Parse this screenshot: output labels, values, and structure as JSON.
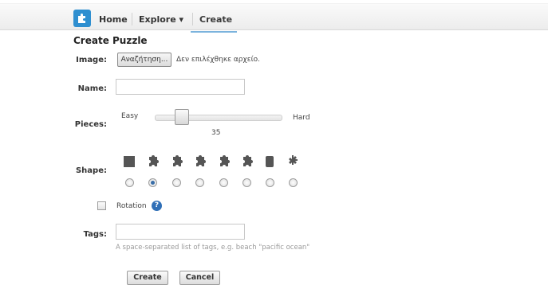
{
  "nav": {
    "home": "Home",
    "explore": "Explore ▾",
    "create": "Create"
  },
  "form": {
    "title": "Create Puzzle",
    "image_label": "Image:",
    "file_button": "Αναζήτηση...",
    "file_status": "Δεν επιλέχθηκε αρχείο.",
    "name_label": "Name:",
    "name_value": "",
    "pieces_label": "Pieces:",
    "easy": "Easy",
    "hard": "Hard",
    "pieces_value": "35",
    "shape_label": "Shape:",
    "shapes": [
      "square",
      "jigsaw",
      "jigsaw",
      "jigsaw",
      "jigsaw",
      "jigsaw",
      "cylinder",
      "gear"
    ],
    "selected_shape_index": 1,
    "rotation_label": "Rotation",
    "tags_label": "Tags:",
    "tags_value": "",
    "tags_hint": "A space-separated list of tags, e.g. beach \"pacific ocean\"",
    "create_button": "Create",
    "cancel_button": "Cancel"
  },
  "colors": {
    "accent": "#2f8fd0",
    "shape_fill": "#555555"
  }
}
